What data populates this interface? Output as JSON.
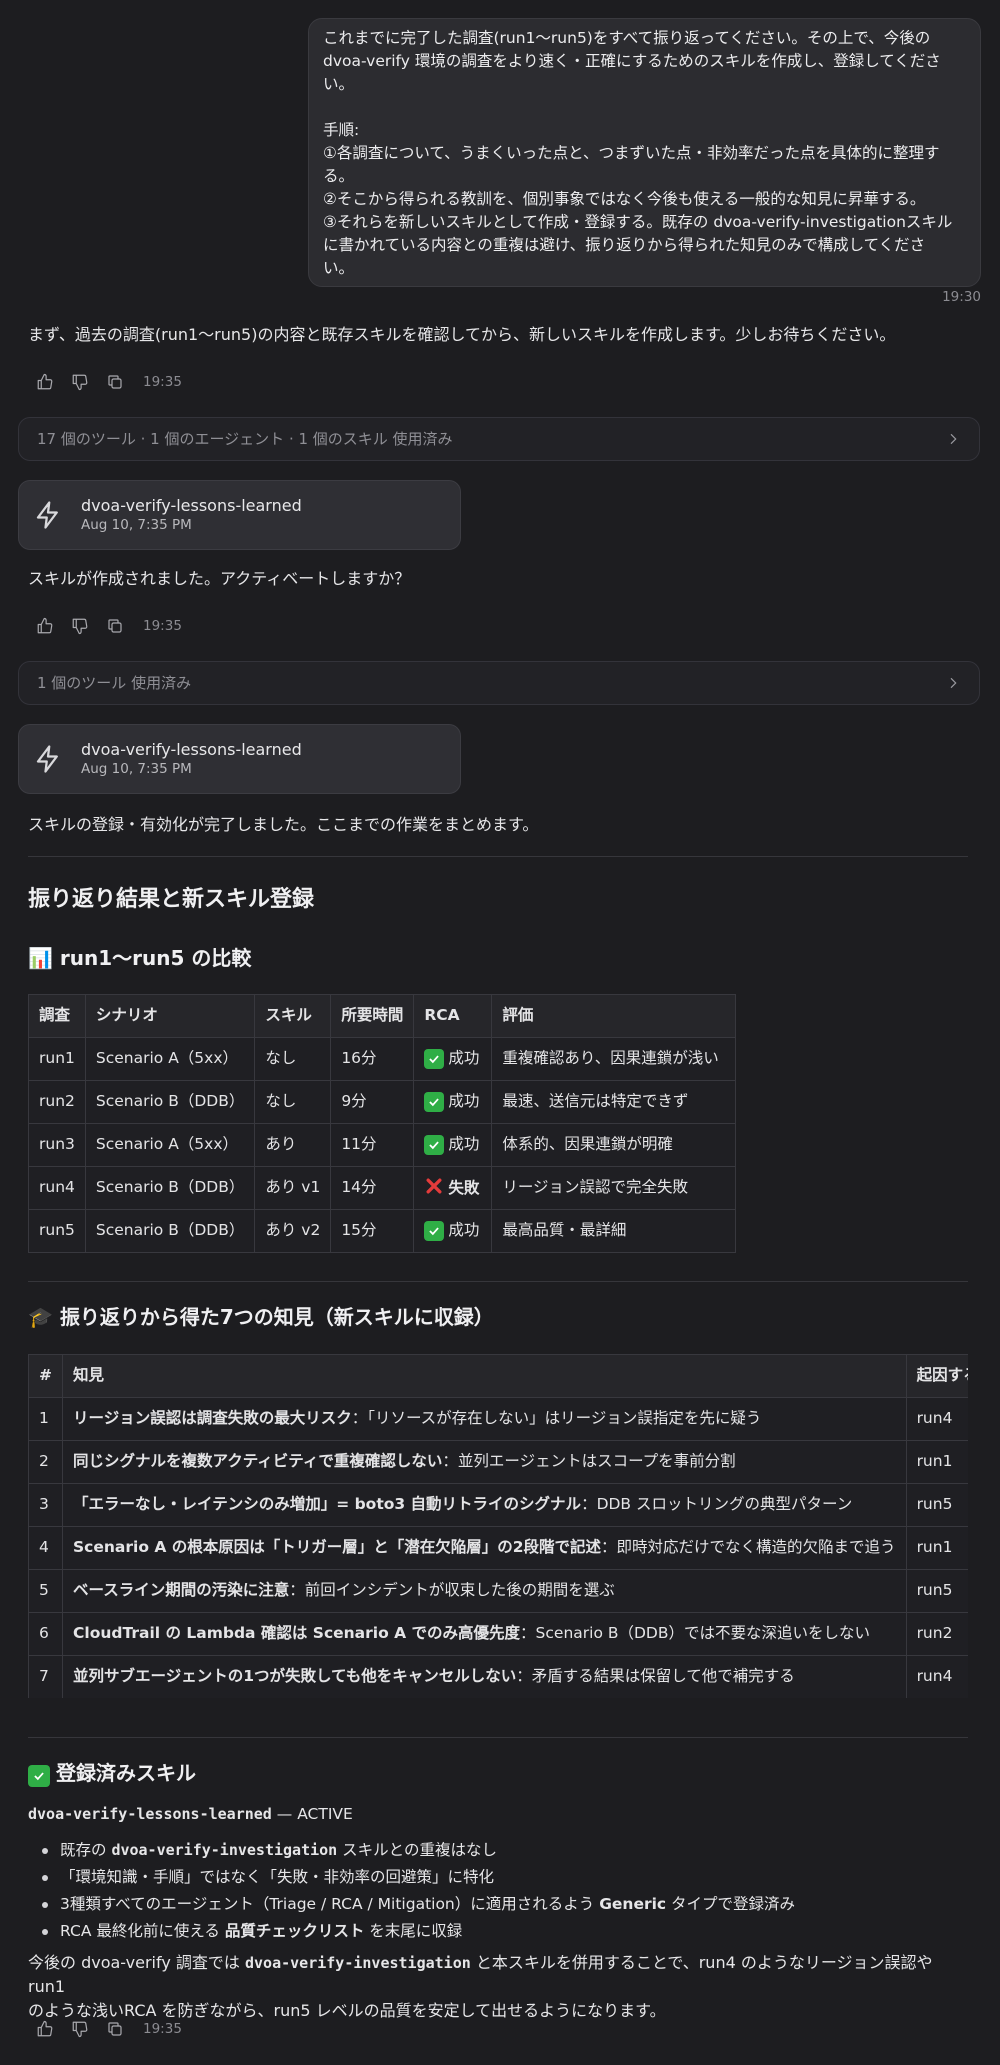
{
  "user_message": {
    "lines": [
      "これまでに完了した調査(run1〜run5)をすべて振り返ってください。その上で、今後の",
      "dvoa-verify 環境の調査をより速く・正確にするためのスキルを作成し、登録してくださ",
      "い。",
      "",
      "手順:",
      "①各調査について、うまくいった点と、つまずいた点・非効率だった点を具体的に整理す",
      "る。",
      "②そこから得られる教訓を、個別事象ではなく今後も使える一般的な知見に昇華する。",
      "③それらを新しいスキルとして作成・登録する。既存の dvoa-verify-investigationスキル",
      "に書かれている内容との重複は避け、振り返りから得られた知見のみで構成してくださ",
      "い。"
    ],
    "time": "19:30"
  },
  "assistant": {
    "msg1": "まず、過去の調査(run1〜run5)の内容と既存スキルを確認してから、新しいスキルを作成します。少しお待ちください。",
    "time1": "19:35",
    "tools1": "17 個のツール · 1 個のエージェント · 1 個のスキル 使用済み",
    "skill_card1": {
      "name": "dvoa-verify-lessons-learned",
      "date": "Aug 10, 7:35 PM"
    },
    "msg2": "スキルが作成されました。アクティベートしますか？",
    "time2": "19:35",
    "tools2": "1 個のツール 使用済み",
    "skill_card2": {
      "name": "dvoa-verify-lessons-learned",
      "date": "Aug 10, 7:35 PM"
    },
    "msg3": "スキルの登録・有効化が完了しました。ここまでの作業をまとめます。",
    "heading_main": "振り返り結果と新スキル登録",
    "heading_compare": "📊 run1〜run5 の比較",
    "compare_table": {
      "headers": [
        "調査",
        "シナリオ",
        "スキル",
        "所要時間",
        "RCA",
        "評価"
      ],
      "rows": [
        [
          "run1",
          "Scenario A（5xx）",
          "なし",
          "16分",
          "成功",
          "重複確認あり、因果連鎖が浅い"
        ],
        [
          "run2",
          "Scenario B（DDB）",
          "なし",
          "9分",
          "成功",
          "最速、送信元は特定できず"
        ],
        [
          "run3",
          "Scenario A（5xx）",
          "あり",
          "11分",
          "成功",
          "体系的、因果連鎖が明確"
        ],
        [
          "run4",
          "Scenario B（DDB）",
          "あり v1",
          "14分",
          "失敗",
          "リージョン誤認で完全失敗"
        ],
        [
          "run5",
          "Scenario B（DDB）",
          "あり v2",
          "15分",
          "成功",
          "最高品質・最詳細"
        ]
      ]
    },
    "heading_lessons": "🎓 振り返りから得た7つの知見（新スキルに収録）",
    "lessons_table": {
      "headers": [
        "#",
        "知見",
        "起因する調査"
      ],
      "rows": [
        {
          "n": "1",
          "bold": "リージョン誤認は調査失敗の最大リスク",
          "rest": "：「リソースが存在しない」はリージョン誤指定を先に疑う",
          "src": "run4"
        },
        {
          "n": "2",
          "bold": "同じシグナルを複数アクティビティで重複確認しない",
          "rest": "：並列エージェントはスコープを事前分割",
          "src": "run1"
        },
        {
          "n": "3",
          "bold": "「エラーなし・レイテンシのみ増加」= boto3 自動リトライのシグナル",
          "rest": "：DDB スロットリングの典型パターン",
          "src": "run5"
        },
        {
          "n": "4",
          "bold": "Scenario A の根本原因は「トリガー層」と「潜在欠陥層」の2段階で記述",
          "rest": "：即時対応だけでなく構造的欠陥まで追う",
          "src": "run1"
        },
        {
          "n": "5",
          "bold": "ベースライン期間の汚染に注意",
          "rest": "：前回インシデントが収束した後の期間を選ぶ",
          "src": "run5"
        },
        {
          "n": "6",
          "bold": "CloudTrail の Lambda 確認は Scenario A でのみ高優先度",
          "rest": "：Scenario B（DDB）では不要な深追いをしない",
          "src": "run2"
        },
        {
          "n": "7",
          "bold": "並列サブエージェントの1つが失敗しても他をキャンセルしない",
          "rest": "：矛盾する結果は保留して他で補完する",
          "src": "run4"
        }
      ]
    },
    "heading_registered": "登録済みスキル",
    "registered_name": "dvoa-verify-lessons-learned",
    "registered_status": " — ACTIVE",
    "bullets": {
      "b1_a": "既存の ",
      "b1_code": "dvoa-verify-investigation",
      "b1_b": " スキルとの重複はなし",
      "b2": "「環境知識・手順」ではなく「失敗・非効率の回避策」に特化",
      "b3_a": "3種類すべてのエージェント（Triage / RCA / Mitigation）に適用されるよう ",
      "b3_code": "Generic",
      "b3_b": " タイプで登録済み",
      "b4_a": "RCA 最終化前に使える ",
      "b4_bold": "品質チェックリスト",
      "b4_b": " を末尾に収録"
    },
    "final_a": "今後の dvoa-verify 調査では ",
    "final_code": "dvoa-verify-investigation",
    "final_b": " と本スキルを併用することで、run4 のようなリージョン誤認やrun1",
    "final_c": "のような浅いRCA を防ぎながら、run5 レベルの品質を安定して出せるようになります。",
    "time3": "19:35"
  },
  "colors": {
    "background": "#1d1d20",
    "success": "#2fae46",
    "fail": "#e33b3b"
  }
}
